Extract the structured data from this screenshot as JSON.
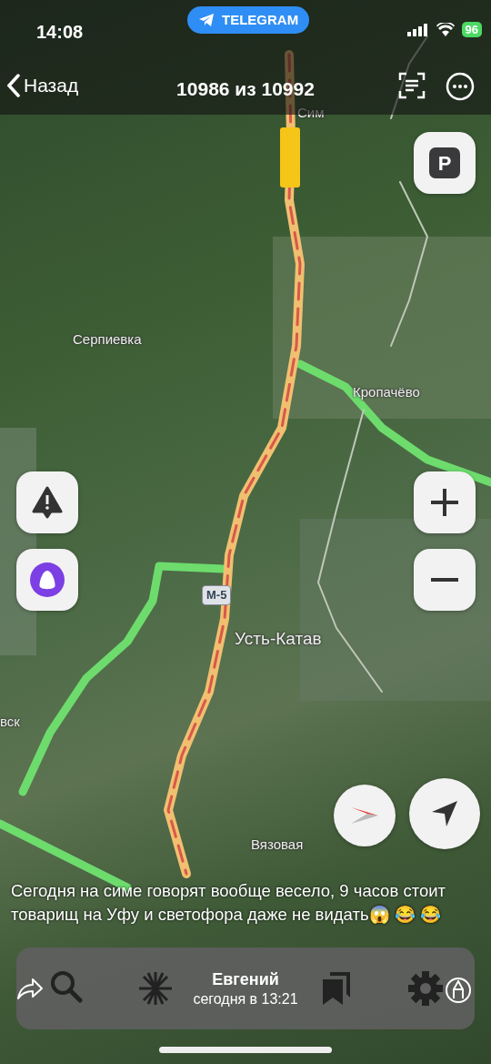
{
  "status_bar": {
    "time": "14:08",
    "app_pill": "TELEGRAM",
    "battery": "96"
  },
  "header": {
    "back": "Назад",
    "counter": "10986 из 10992"
  },
  "map": {
    "places": [
      {
        "label": "Сим",
        "kind": "town"
      },
      {
        "label": "Серпиевка",
        "kind": "village"
      },
      {
        "label": "Кропачёво",
        "kind": "village"
      },
      {
        "label": "М-5",
        "kind": "shield"
      },
      {
        "label": "Усть-Катав",
        "kind": "city"
      },
      {
        "label": "вск",
        "kind": "town"
      },
      {
        "label": "Вязовая",
        "kind": "village"
      }
    ],
    "controls": [
      {
        "kind": "parking",
        "label": "P"
      },
      {
        "kind": "alert"
      },
      {
        "kind": "assistant"
      },
      {
        "kind": "zoom_in"
      },
      {
        "kind": "zoom_out"
      },
      {
        "kind": "compass"
      },
      {
        "kind": "locate"
      }
    ]
  },
  "caption": "Сегодня на симе говорят вообще весело, 9 часов стоит товарищ на Уфу и светофора даже не видать😱 😂 😂",
  "footer": {
    "author": "Евгений",
    "date": "сегодня в 13:21"
  }
}
